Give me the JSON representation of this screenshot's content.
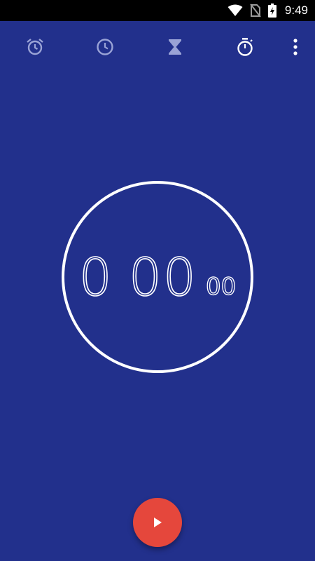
{
  "status_bar": {
    "time": "9:49",
    "icons": [
      "wifi-icon",
      "no-sim-icon",
      "battery-charging-icon"
    ]
  },
  "tabs": [
    {
      "icon": "alarm-icon",
      "selected": false
    },
    {
      "icon": "clock-icon",
      "selected": false
    },
    {
      "icon": "hourglass-icon",
      "selected": false
    },
    {
      "icon": "stopwatch-icon",
      "selected": true
    }
  ],
  "menu": {
    "icon": "more-vert-icon"
  },
  "stopwatch": {
    "minutes": "0",
    "seconds": "00",
    "hundredths": "00"
  },
  "fab": {
    "icon": "play-icon"
  },
  "colors": {
    "background": "#22308c",
    "accent": "#e5473c",
    "inactive_icon": "#9aa3d6",
    "active_icon": "#ffffff",
    "status_bar": "#000000"
  }
}
